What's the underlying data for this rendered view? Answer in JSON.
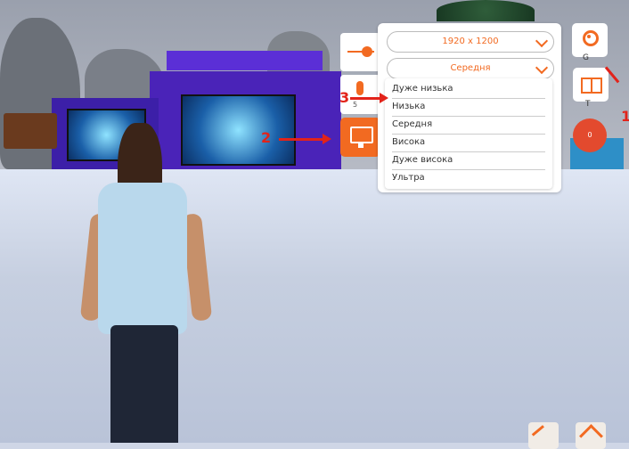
{
  "resolution": {
    "value": "1920 x 1200"
  },
  "quality": {
    "value": "Середня",
    "options": [
      "Дуже низька",
      "Низька",
      "Середня",
      "Висока",
      "Дуже висока",
      "Ультра"
    ]
  },
  "right_toolbar": {
    "gear_shortcut": "G",
    "book_shortcut": "T",
    "counter": "0"
  },
  "left_toolbar": {
    "mic_label": "5"
  },
  "annotations": {
    "n1": "1",
    "n2": "2",
    "n3": "3"
  },
  "colors": {
    "accent": "#f26a21",
    "annotation": "#e2231a"
  }
}
